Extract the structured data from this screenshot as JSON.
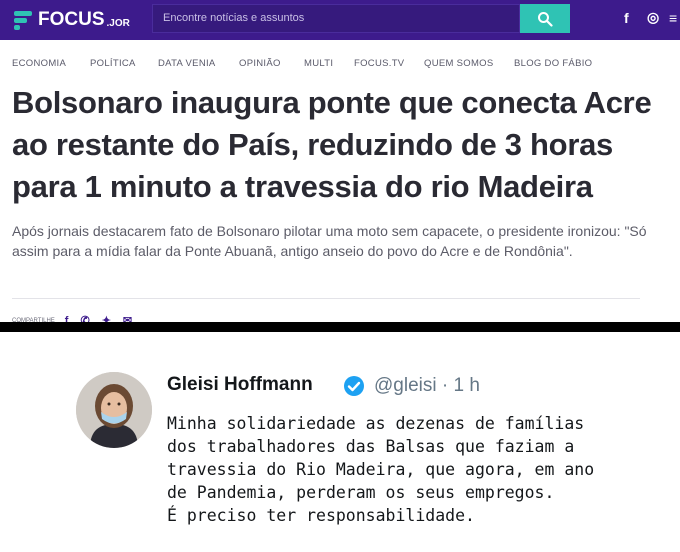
{
  "header": {
    "logo_text": "FOCUS",
    "logo_suffix": ".JOR",
    "search_placeholder": "Encontre notícias e assuntos",
    "social": [
      "f",
      "◎",
      "≡"
    ],
    "colors": {
      "bar": "#3d1b8c",
      "accent": "#2fc3b4"
    }
  },
  "nav": {
    "items": [
      "ECONOMIA",
      "POLÍTICA",
      "DATA VENIA",
      "OPINIÃO",
      "MULTI",
      "FOCUS.TV",
      "QUEM SOMOS",
      "BLOG DO FÁBIO"
    ]
  },
  "article": {
    "headline": "Bolsonaro inaugura ponte que conecta Acre ao restante do País, reduzindo de 3 horas para 1 minuto a travessia do rio Madeira",
    "lede": "Após jornais destacarem fato de Bolsonaro pilotar uma moto sem capacete, o presidente ironizou: \"Só assim para a mídia falar da Ponte Abuanã, antigo anseio do povo do Acre e de Rondônia\".",
    "share_label": "COMPARTILHE",
    "share_icons": [
      "facebook-icon",
      "whatsapp-icon",
      "twitter-icon",
      "email-icon"
    ]
  },
  "tweet": {
    "name": "Gleisi Hoffmann",
    "handle": "@gleisi · 1 h",
    "text": "Minha solidariedade as dezenas de famílias\ndos trabalhadores das Balsas que faziam a\ntravessia do Rio Madeira, que agora, em ano\nde Pandemia, perderam os seus empregos.\nÉ preciso ter responsabilidade.",
    "verified_color": "#1da1f2"
  }
}
